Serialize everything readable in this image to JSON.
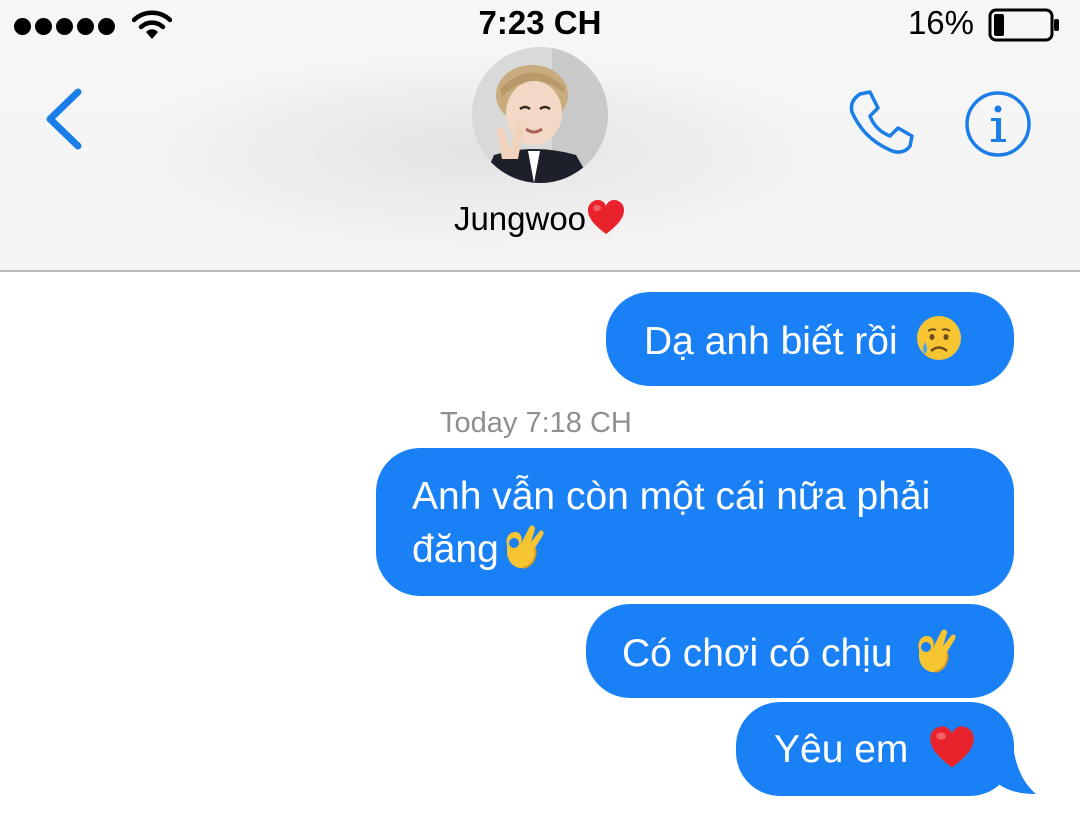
{
  "status_bar": {
    "time": "7:23 CH",
    "battery": "16%",
    "signal_icon": "signal-dots-icon",
    "wifi_icon": "wifi-icon",
    "battery_icon": "battery-low-icon"
  },
  "header": {
    "back_icon": "chevron-left-icon",
    "contact_name": "Jungwoo",
    "contact_emoji": "heart-emoji",
    "call_icon": "phone-icon",
    "info_icon": "info-icon"
  },
  "messages": [
    {
      "text": "Dạ anh biết rồi",
      "emoji": "crying-face-emoji",
      "sender": "me"
    },
    {
      "timestamp": "Today 7:18 CH"
    },
    {
      "text_line1": "Anh vẫn còn một cái nữa phải",
      "text_line2": "đăng",
      "emoji": "ok-hand-emoji",
      "sender": "me"
    },
    {
      "text": "Có chơi có chịu",
      "emoji": "ok-hand-emoji",
      "sender": "me"
    },
    {
      "text": "Yêu em",
      "emoji": "heart-emoji",
      "sender": "me"
    }
  ],
  "colors": {
    "bubble": "#1a80f5",
    "accent": "#1a7ee6",
    "timestamp": "#8e8e93"
  }
}
